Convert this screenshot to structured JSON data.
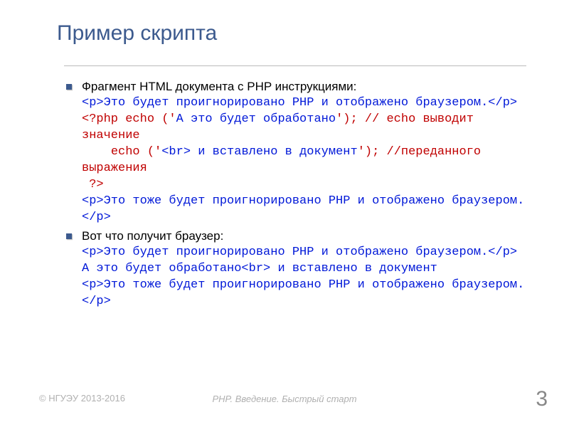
{
  "title": "Пример скрипта",
  "bullet1_intro": "Фрагмент HTML документа с PHP инструкциями:",
  "code1": {
    "l1_blue": "<p>Это будет проигнорировано PHP и отображено браузером.</p>",
    "l2_red1": "<?php echo ('",
    "l2_blue": "А это будет обработано",
    "l2_red2": "'); // echo выводит значение",
    "l3_red1": "    echo ('",
    "l3_blue": "<br> и вставлено в документ",
    "l3_red2": "'); //переданного выражения",
    "l4_red": " ?>",
    "l5_blue": "<p>Это тоже будет проигнорировано PHP и отображено браузером.</p>"
  },
  "bullet2_intro": "Вот что получит браузер:",
  "code2": {
    "l1": "<p>Это будет проигнорировано PHP и отображено браузером.</p>",
    "l2": "А это будет обработано<br> и вставлено в документ",
    "l3": "<p>Это тоже будет проигнорировано PHP и отображено браузером.</p>"
  },
  "footer_left": "© НГУЭУ 2013-2016",
  "footer_center": "PHP. Введение. Быстрый старт",
  "page_number": "3"
}
